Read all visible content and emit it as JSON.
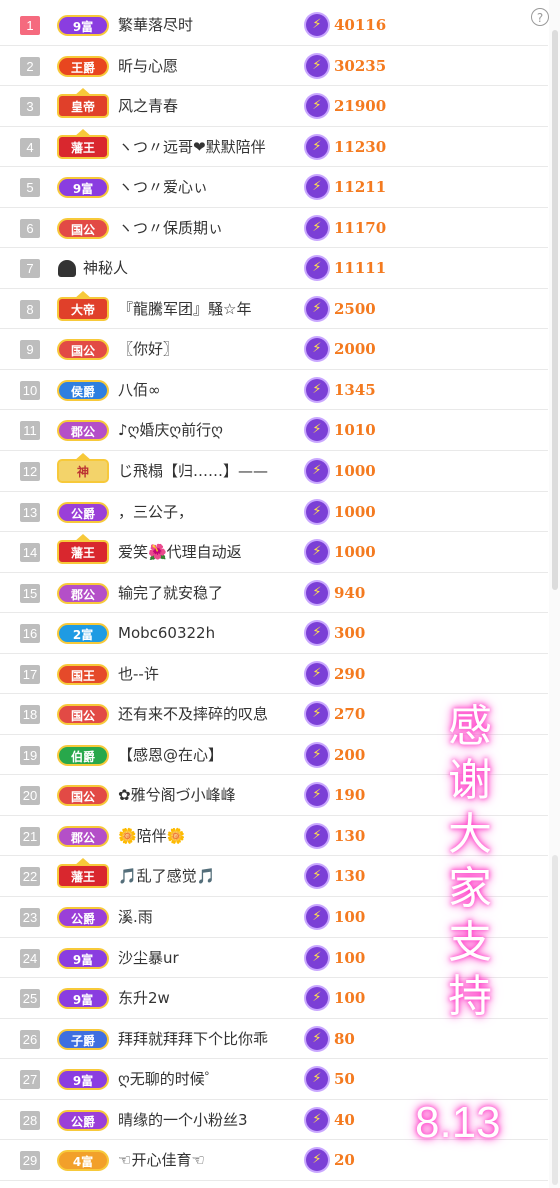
{
  "help_glyph": "?",
  "coin_glyph": "⚡",
  "badge_colors": {
    "9富": "#8a3de0",
    "王爵": "#e8461f",
    "皇帝": "#e0402a",
    "藩王": "#d9272e",
    "国公": "#e24a45",
    "大帝": "#e0402a",
    "侯爵": "#2f7fe0",
    "郡公": "#b44fc8",
    "神": "#f3d36a",
    "公爵": "#9a3fd8",
    "2富": "#1f9be3",
    "国王": "#e54a2a",
    "伯爵": "#28a84b",
    "子爵": "#3f6fe0",
    "4富": "#f2a02a"
  },
  "rows": [
    {
      "rank": "1",
      "badge": "9富",
      "name": "繁華落尽时",
      "amount": "40116"
    },
    {
      "rank": "2",
      "badge": "王爵",
      "name": "昕与心愿",
      "amount": "30235"
    },
    {
      "rank": "3",
      "badge": "皇帝",
      "name": "风之青春",
      "amount": "21900"
    },
    {
      "rank": "4",
      "badge": "藩王",
      "name": "ヽつ〃远哥❤默默陪伴",
      "amount": "11230"
    },
    {
      "rank": "5",
      "badge": "9富",
      "name": "ヽつ〃爱心ぃ",
      "amount": "11211"
    },
    {
      "rank": "6",
      "badge": "国公",
      "name": "ヽつ〃保质期ぃ",
      "amount": "11170"
    },
    {
      "rank": "7",
      "badge": "",
      "name": "神秘人",
      "amount": "11111"
    },
    {
      "rank": "8",
      "badge": "大帝",
      "name": "『龍騰军团』騒☆年",
      "amount": "2500"
    },
    {
      "rank": "9",
      "badge": "国公",
      "name": "〖你好〗",
      "amount": "2000"
    },
    {
      "rank": "10",
      "badge": "侯爵",
      "name": "八佰∞",
      "amount": "1345"
    },
    {
      "rank": "11",
      "badge": "郡公",
      "name": "♪ღ婚庆ღ前行ღ",
      "amount": "1010"
    },
    {
      "rank": "12",
      "badge": "神",
      "name": "じ飛榻【归……】——",
      "amount": "1000"
    },
    {
      "rank": "13",
      "badge": "公爵",
      "name": "，三公子，",
      "amount": "1000"
    },
    {
      "rank": "14",
      "badge": "藩王",
      "name": "爱笑🌺代理自动返",
      "amount": "1000"
    },
    {
      "rank": "15",
      "badge": "郡公",
      "name": "输完了就安稳了",
      "amount": "940"
    },
    {
      "rank": "16",
      "badge": "2富",
      "name": "Mobc60322h",
      "amount": "300"
    },
    {
      "rank": "17",
      "badge": "国王",
      "name": "也--许",
      "amount": "290"
    },
    {
      "rank": "18",
      "badge": "国公",
      "name": "还有来不及摔碎的叹息",
      "amount": "270"
    },
    {
      "rank": "19",
      "badge": "伯爵",
      "name": "【感恩@在心】",
      "amount": "200"
    },
    {
      "rank": "20",
      "badge": "国公",
      "name": "✿雅兮阁づ小峰峰",
      "amount": "190"
    },
    {
      "rank": "21",
      "badge": "郡公",
      "name": "🌼陪伴🌼",
      "amount": "130"
    },
    {
      "rank": "22",
      "badge": "藩王",
      "name": "🎵乱了感觉🎵",
      "amount": "130"
    },
    {
      "rank": "23",
      "badge": "公爵",
      "name": "溪.雨",
      "amount": "100"
    },
    {
      "rank": "24",
      "badge": "9富",
      "name": "沙尘暴ur",
      "amount": "100"
    },
    {
      "rank": "25",
      "badge": "9富",
      "name": "东升2w",
      "amount": "100"
    },
    {
      "rank": "26",
      "badge": "子爵",
      "name": "拜拜就拜拜下个比你乖",
      "amount": "80"
    },
    {
      "rank": "27",
      "badge": "9富",
      "name": "ღ无聊的时候゜",
      "amount": "50"
    },
    {
      "rank": "28",
      "badge": "公爵",
      "name": "晴缘的一个小粉丝3",
      "amount": "40"
    },
    {
      "rank": "29",
      "badge": "4富",
      "name": "☜开心佳育☜",
      "amount": "20"
    }
  ],
  "overlay": {
    "thanks_chars": [
      "感",
      "谢",
      "大",
      "家",
      "支",
      "持"
    ],
    "date": "8.13"
  }
}
